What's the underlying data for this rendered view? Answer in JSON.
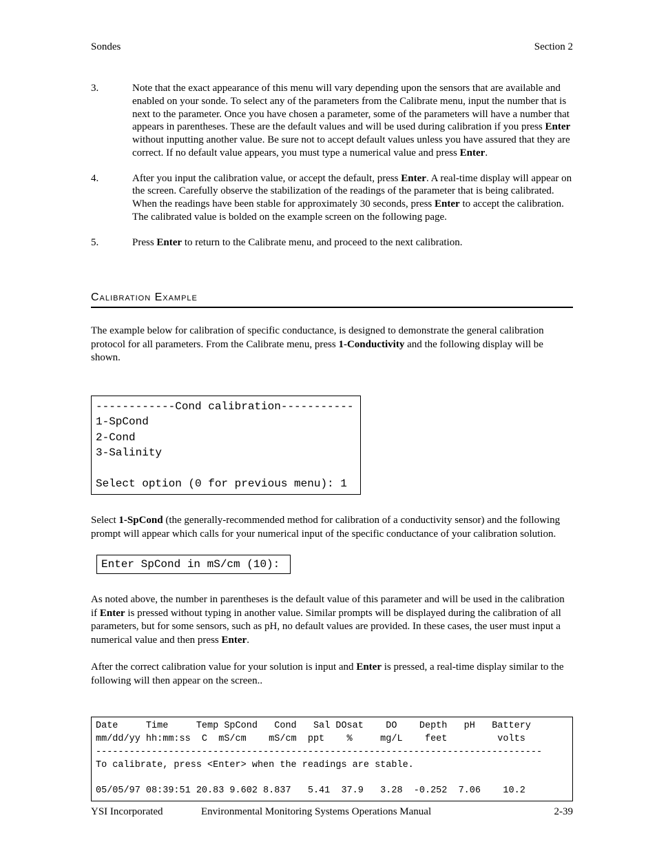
{
  "header": {
    "left": "Sondes",
    "right": "Section 2"
  },
  "items": [
    {
      "n": "3.",
      "parts": [
        "Note that the exact appearance of this menu will vary depending upon the sensors that are available and enabled on your sonde.  To select any of the parameters from the Calibrate menu, input the number that is next to the parameter. Once you have chosen a parameter, some of the parameters will have a number that appears in parentheses. These are the default values and will be used during calibration if you press ",
        "Enter",
        " without inputting another value. Be sure not to accept default values unless you have assured that they are correct.  If no default value appears, you must type a numerical value and press ",
        "Enter",
        "."
      ]
    },
    {
      "n": "4.",
      "parts": [
        "After you input the calibration value, or accept the default, press ",
        "Enter",
        ". A real-time display will appear on the screen. Carefully observe the stabilization of the readings of the parameter that is being calibrated. When the readings have been stable for approximately 30 seconds, press ",
        "Enter",
        " to accept the calibration. The calibrated value is bolded on the example screen on the following page."
      ]
    },
    {
      "n": "5.",
      "parts": [
        "Press ",
        "Enter",
        " to return to the Calibrate menu, and proceed to the next calibration."
      ]
    }
  ],
  "section_title": "Calibration Example",
  "intro_parts": [
    "The example below for calibration of specific conductance, is designed to demonstrate the general calibration protocol for all parameters.  From the Calibrate menu, press ",
    "1-Conductivity",
    " and the following display will be shown."
  ],
  "console1": "------------Cond calibration-----------\n1-SpCond\n2-Cond\n3-Salinity\n\nSelect option (0 for previous menu): 1",
  "mid_parts": [
    "Select ",
    "1-SpCond",
    " (the generally-recommended method for calibration of a conductivity sensor) and the following prompt will appear which calls for your numerical input of the specific conductance of your calibration solution."
  ],
  "console2": "Enter SpCond in mS/cm (10):",
  "post1_parts": [
    "As noted above, the number in parentheses is the default value of this parameter and will be used in the calibration if         ",
    "Enter",
    " is pressed without typing in another value.  Similar prompts will be displayed during the calibration of all parameters, but for some sensors, such as pH, no default values are provided.  In these cases, the user must input a numerical value and then press ",
    "Enter",
    "."
  ],
  "post2_parts": [
    "After the correct calibration value for your solution is input and ",
    "Enter",
    " is pressed, a real-time display similar to the following will then appear on the screen.."
  ],
  "console3": "Date     Time     Temp SpCond   Cond   Sal DOsat    DO    Depth   pH   Battery\nmm/dd/yy hh:mm:ss  C  mS/cm    mS/cm  ppt    %     mg/L    feet         volts\n--------------------------------------------------------------------------------\nTo calibrate, press <Enter> when the readings are stable.\n\n05/05/97 08:39:51 20.83 9.602 8.837   5.41  37.9   3.28  -0.252  7.06    10.2",
  "footer": {
    "org": "YSI Incorporated",
    "title": "Environmental Monitoring Systems Operations Manual",
    "pageno": "2-39"
  }
}
